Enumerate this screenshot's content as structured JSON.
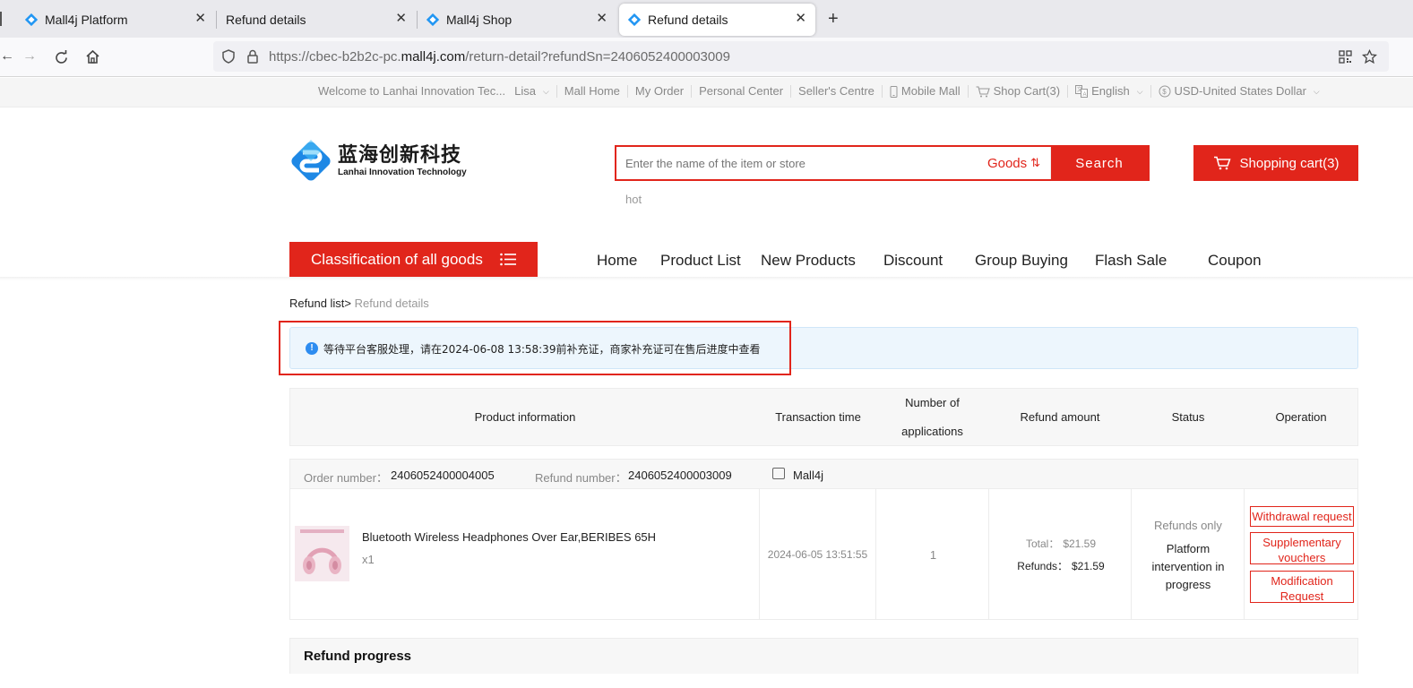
{
  "browser": {
    "tabs": [
      {
        "title": "Mall4j Platform",
        "active": false
      },
      {
        "title": "Refund details",
        "active": false
      },
      {
        "title": "Mall4j Shop",
        "active": false
      },
      {
        "title": "Refund details",
        "active": true
      }
    ],
    "url_prefix": "https://cbec-b2b2c-pc.",
    "url_domain": "mall4j.com",
    "url_path": "/return-detail?refundSn=2406052400003009"
  },
  "topbar": {
    "welcome": "Welcome to Lanhai Innovation Tec...",
    "user": "Lisa",
    "mall_home": "Mall Home",
    "my_order": "My Order",
    "personal_center": "Personal Center",
    "sellers_centre": "Seller's Centre",
    "mobile_mall": "Mobile Mall",
    "shop_cart": "Shop Cart(3)",
    "language": "English",
    "currency": "USD-United States Dollar"
  },
  "header": {
    "logo_cn": "蓝海创新科技",
    "logo_en": "Lanhai Innovation Technology",
    "search_placeholder": "Enter the name of the item or store",
    "search_type": "Goods",
    "search_button": "Search",
    "hot_label": "hot",
    "cart_button": "Shopping cart(3)"
  },
  "nav": {
    "category_button": "Classification of all goods",
    "items": [
      "Home",
      "Product List",
      "New Products",
      "Discount",
      "Group Buying",
      "Flash Sale",
      "Coupon"
    ]
  },
  "breadcrumb": {
    "parent": "Refund list",
    "separator": ">",
    "current": "Refund details"
  },
  "alert": {
    "text": "等待平台客服处理，请在2024-06-08 13:58:39前补充证，商家补充证可在售后进度中查看"
  },
  "table": {
    "headers": {
      "product": "Product information",
      "time": "Transaction time",
      "count_line1": "Number of",
      "count_line2": "applications",
      "amount": "Refund amount",
      "status": "Status",
      "operation": "Operation"
    },
    "order_label": "Order number：",
    "order_number": "2406052400004005",
    "refund_label": "Refund number：",
    "refund_number": "2406052400003009",
    "store_name": "Mall4j",
    "item": {
      "name": "Bluetooth Wireless Headphones Over Ear,BERIBES 65H",
      "qty": "x1",
      "transaction_time": "2024-06-05 13:51:55",
      "applications": "1",
      "total_label": "Total：",
      "total": "$21.59",
      "refunds_label": "Refunds：",
      "refunds": "$21.59",
      "status_type": "Refunds only",
      "status_line1": "Platform",
      "status_line2": "intervention in",
      "status_line3": "progress",
      "op_withdrawal": "Withdrawal request",
      "op_supp_line1": "Supplementary",
      "op_supp_line2": "vouchers",
      "op_mod_line1": "Modification",
      "op_mod_line2": "Request"
    }
  },
  "progress": {
    "title": "Refund progress"
  },
  "colors": {
    "brand_red": "#e1251b",
    "info_blue": "#2d8cf0"
  }
}
